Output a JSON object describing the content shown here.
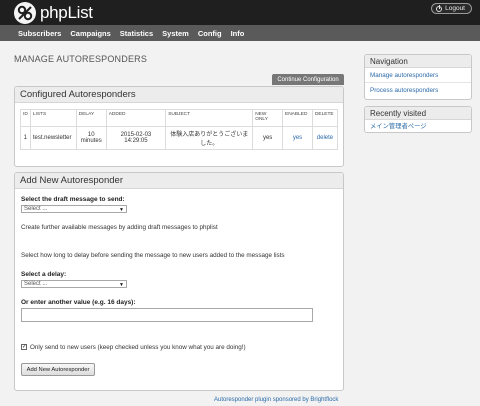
{
  "app": {
    "name": "phpList",
    "logout_label": "Logout"
  },
  "nav": {
    "items": [
      "Subscribers",
      "Campaigns",
      "Statistics",
      "System",
      "Config",
      "Info"
    ]
  },
  "page": {
    "title": "MANAGE AUTORESPONDERS",
    "config_button": "Continue Configuration"
  },
  "configured": {
    "title": "Configured Autoresponders",
    "columns": [
      "ID",
      "LISTS",
      "DELAY",
      "ADDED",
      "SUBJECT",
      "NEW ONLY",
      "ENABLED",
      "DELETE"
    ],
    "rows": [
      {
        "id": "1",
        "lists": "test.newsletter",
        "delay": "10 minutes",
        "added": "2015-02-03 14:29:05",
        "subject": "体験入店ありがとうございました。",
        "new_only": "yes",
        "enabled": "yes",
        "delete": "delete"
      }
    ]
  },
  "add": {
    "title": "Add New Autoresponder",
    "draft_label": "Select the draft message to send:",
    "draft_value": "Select ...",
    "draft_help": "Create further available messages by adding draft messages to phplist",
    "delay_help": "Select how long to delay before sending the message to new users added to the message lists",
    "delay_label": "Select a delay:",
    "delay_value": "Select ...",
    "other_label": "Or enter another value (e.g. 16 days):",
    "other_value": "",
    "checkbox_label": "Only send to new users (keep checked unless you know what you are doing!)",
    "checkbox_checked": true,
    "submit_label": "Add New Autoresponder"
  },
  "sponsor": "Autoresponder plugin sponsored by Brightflock",
  "sidebar": {
    "nav_title": "Navigation",
    "nav_links": [
      "Manage autoresponders",
      "Process autoresponders"
    ],
    "recent_title": "Recently visited",
    "recent_links": [
      "メイン管理者ページ"
    ]
  },
  "colors": {
    "topbar": "#1f1f1f",
    "navbar": "#5a5a5a",
    "link": "#2a6aa8",
    "background": "#f2f2f2"
  }
}
